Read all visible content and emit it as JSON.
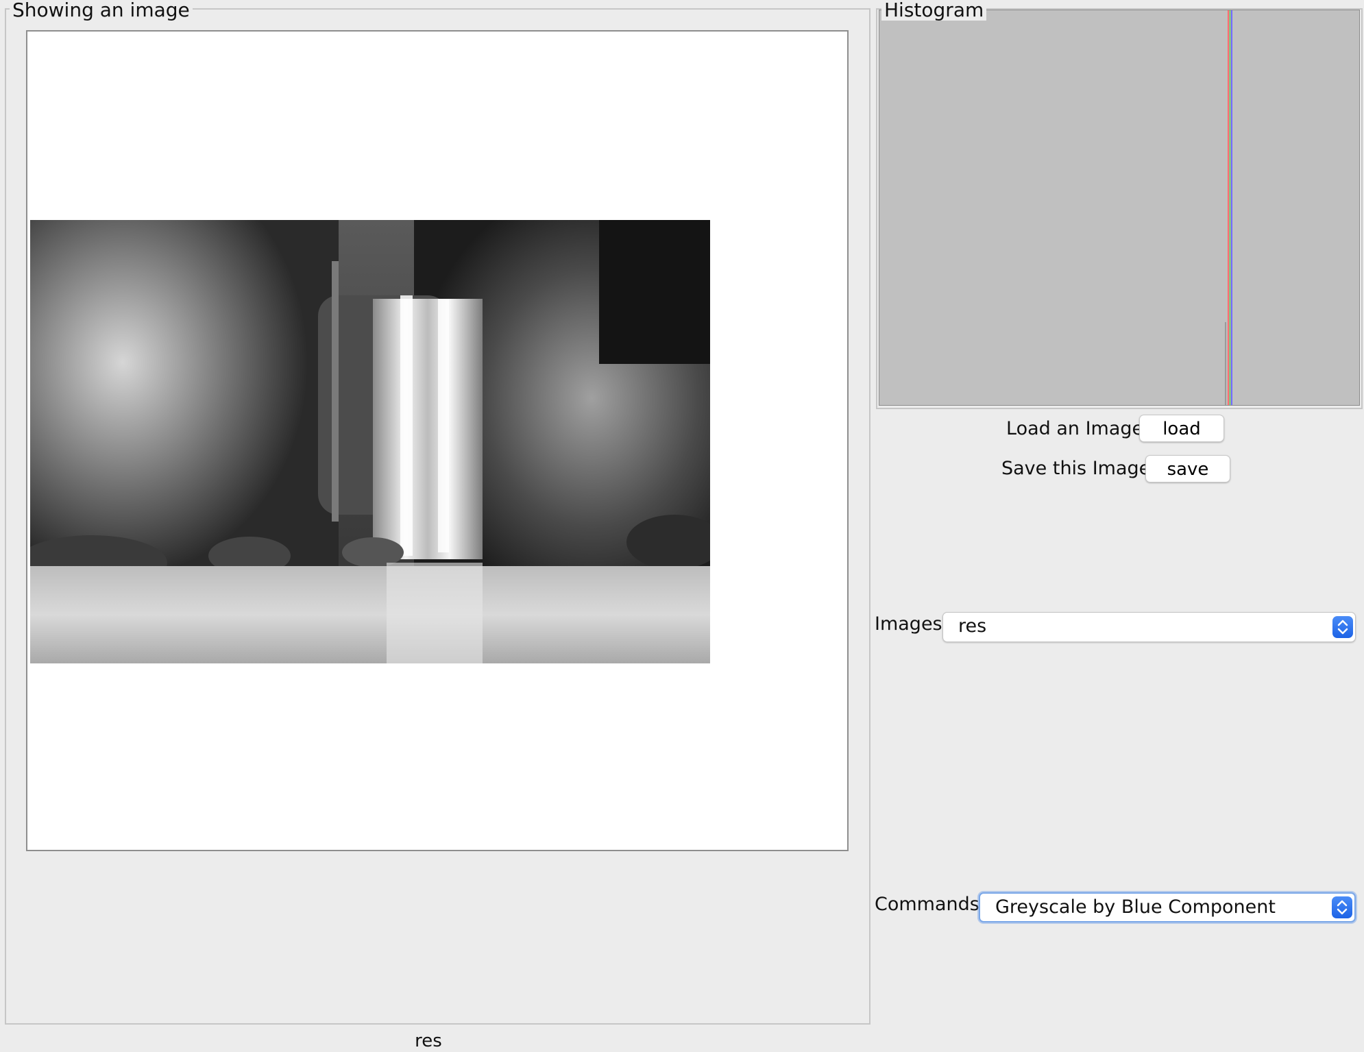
{
  "left_panel": {
    "title": "Showing an image"
  },
  "status": {
    "text": "res"
  },
  "histogram": {
    "title": "Histogram",
    "colors": {
      "background": "#c0c0c0",
      "red": "#ff6a6a",
      "green": "#36c236",
      "blue": "#6a6aff"
    }
  },
  "controls": {
    "load_label": "Load an Image",
    "load_button": "load",
    "save_label": "Save this Image",
    "save_button": "save",
    "images_label": "Images",
    "images_selected": "res",
    "commands_label": "Commands",
    "commands_selected": "Greyscale by Blue Component"
  }
}
